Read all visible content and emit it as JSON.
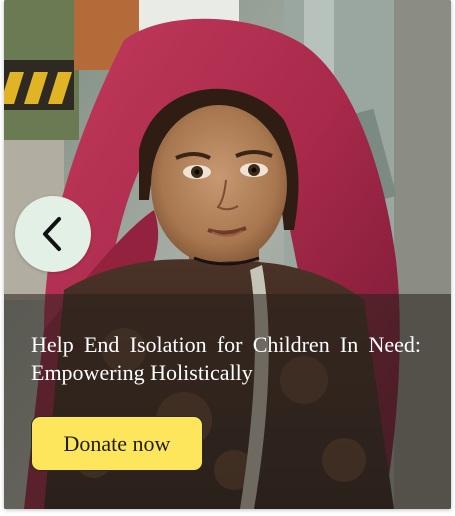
{
  "hero": {
    "headline": "Help End Isolation for Children In Need: Empowering Holistically",
    "donate_label": "Donate now"
  },
  "icons": {
    "back": "chevron-left-icon"
  },
  "colors": {
    "back_button_bg": "#e3f0e5",
    "donate_button_bg": "#fde65c",
    "headscarf": "#a8294a",
    "overlay": "#28201c"
  }
}
